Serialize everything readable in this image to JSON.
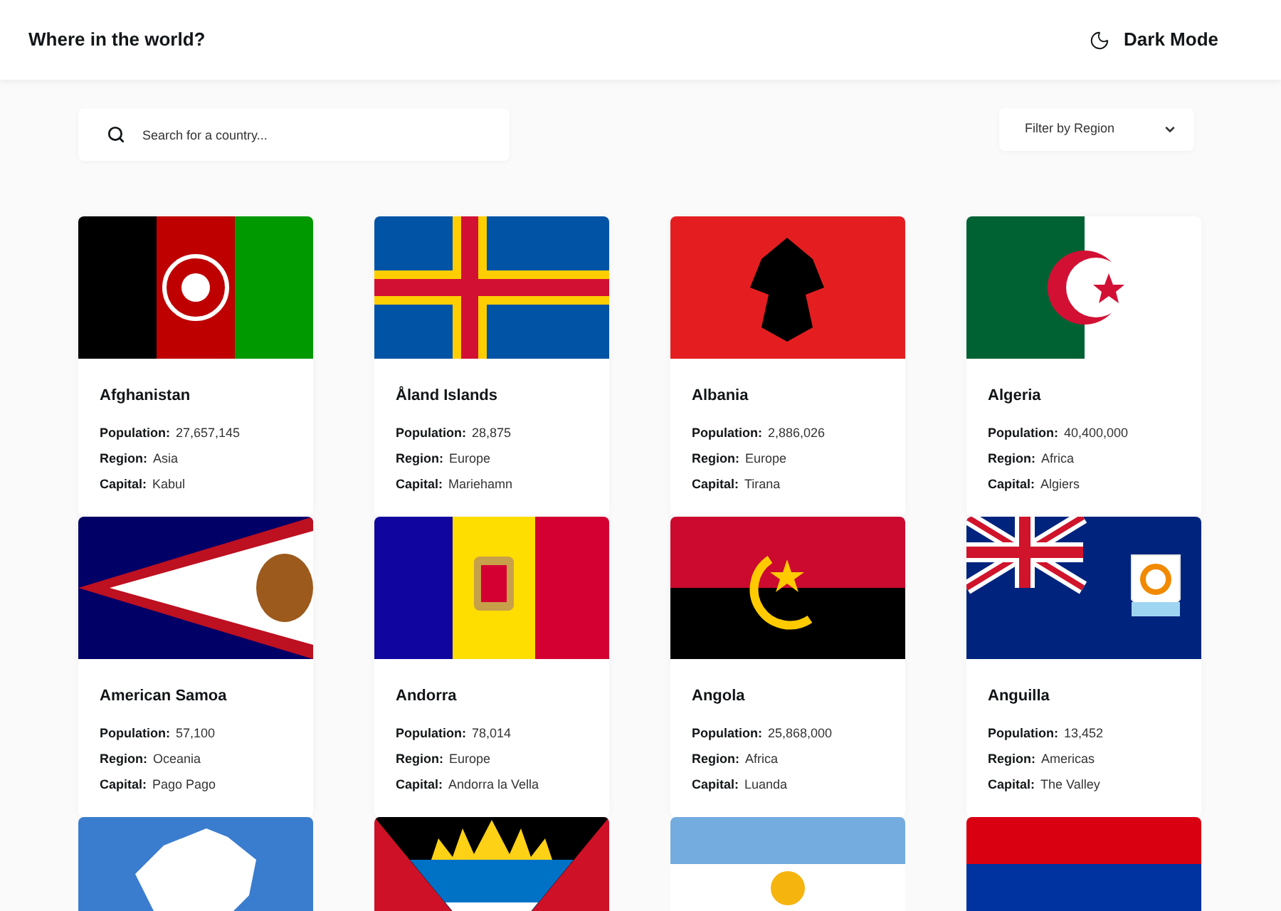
{
  "header": {
    "title": "Where in the world?",
    "theme_toggle": "Dark Mode"
  },
  "search": {
    "placeholder": "Search for a country..."
  },
  "filter": {
    "label": "Filter by Region"
  },
  "countries": [
    {
      "kind": "full",
      "name": "Afghanistan",
      "population_label": "Population:",
      "population": "27,657,145",
      "region_label": "Region:",
      "region": "Asia",
      "capital_label": "Capital:",
      "capital": "Kabul"
    },
    {
      "kind": "full",
      "name": "Åland Islands",
      "population_label": "Population:",
      "population": "28,875",
      "region_label": "Region:",
      "region": "Europe",
      "capital_label": "Capital:",
      "capital": "Mariehamn"
    },
    {
      "kind": "full",
      "name": "Albania",
      "population_label": "Population:",
      "population": "2,886,026",
      "region_label": "Region:",
      "region": "Europe",
      "capital_label": "Capital:",
      "capital": "Tirana"
    },
    {
      "kind": "full",
      "name": "Algeria",
      "population_label": "Population:",
      "population": "40,400,000",
      "region_label": "Region:",
      "region": "Africa",
      "capital_label": "Capital:",
      "capital": "Algiers"
    },
    {
      "kind": "full",
      "name": "American Samoa",
      "population_label": "Population:",
      "population": "57,100",
      "region_label": "Region:",
      "region": "Oceania",
      "capital_label": "Capital:",
      "capital": "Pago Pago"
    },
    {
      "kind": "full",
      "name": "Andorra",
      "population_label": "Population:",
      "population": "78,014",
      "region_label": "Region:",
      "region": "Europe",
      "capital_label": "Capital:",
      "capital": "Andorra la Vella"
    },
    {
      "kind": "full",
      "name": "Angola",
      "population_label": "Population:",
      "population": "25,868,000",
      "region_label": "Region:",
      "region": "Africa",
      "capital_label": "Capital:",
      "capital": "Luanda"
    },
    {
      "kind": "full",
      "name": "Anguilla",
      "population_label": "Population:",
      "population": "13,452",
      "region_label": "Region:",
      "region": "Americas",
      "capital_label": "Capital:",
      "capital": "The Valley"
    },
    {
      "kind": "flag_only"
    },
    {
      "kind": "flag_only"
    },
    {
      "kind": "flag_only"
    },
    {
      "kind": "flag_only"
    }
  ]
}
